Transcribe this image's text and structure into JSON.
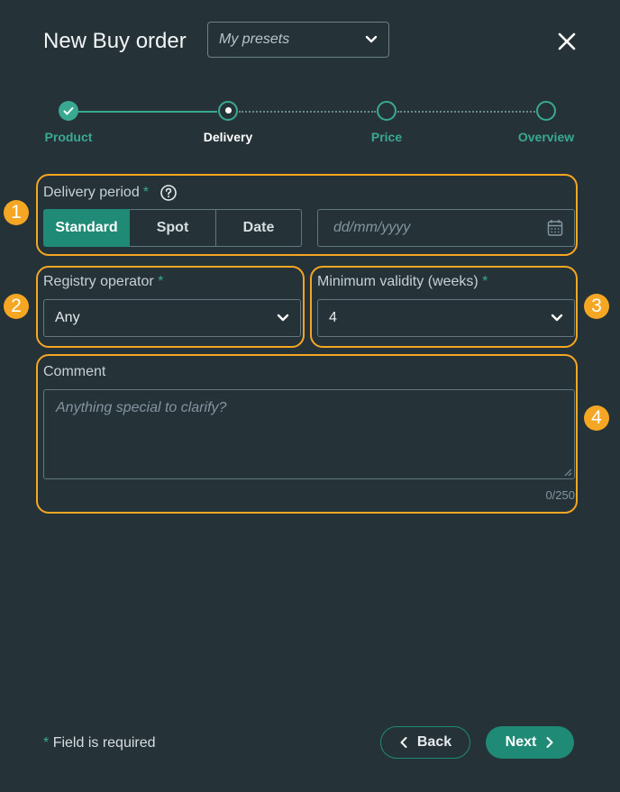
{
  "header": {
    "title": "New Buy order",
    "presets_placeholder": "My presets"
  },
  "stepper": {
    "steps": [
      {
        "label": "Product",
        "state": "completed"
      },
      {
        "label": "Delivery",
        "state": "current"
      },
      {
        "label": "Price",
        "state": "upcoming"
      },
      {
        "label": "Overview",
        "state": "upcoming"
      }
    ]
  },
  "annotations": [
    "1",
    "2",
    "3",
    "4"
  ],
  "delivery": {
    "label": "Delivery period",
    "required_mark": "*",
    "options": [
      "Standard",
      "Spot",
      "Date"
    ],
    "selected": "Standard",
    "date_placeholder": "dd/mm/yyyy"
  },
  "registry": {
    "label": "Registry operator",
    "required_mark": "*",
    "value": "Any"
  },
  "validity": {
    "label": "Minimum validity (weeks)",
    "required_mark": "*",
    "value": "4"
  },
  "comment": {
    "label": "Comment",
    "placeholder": "Anything special to clarify?",
    "counter": "0/250"
  },
  "footer": {
    "required_mark": "*",
    "required_note": "Field is required",
    "back_label": "Back",
    "next_label": "Next"
  },
  "colors": {
    "background": "#253238",
    "accent": "#1f8a76",
    "highlight": "#f5a623"
  }
}
